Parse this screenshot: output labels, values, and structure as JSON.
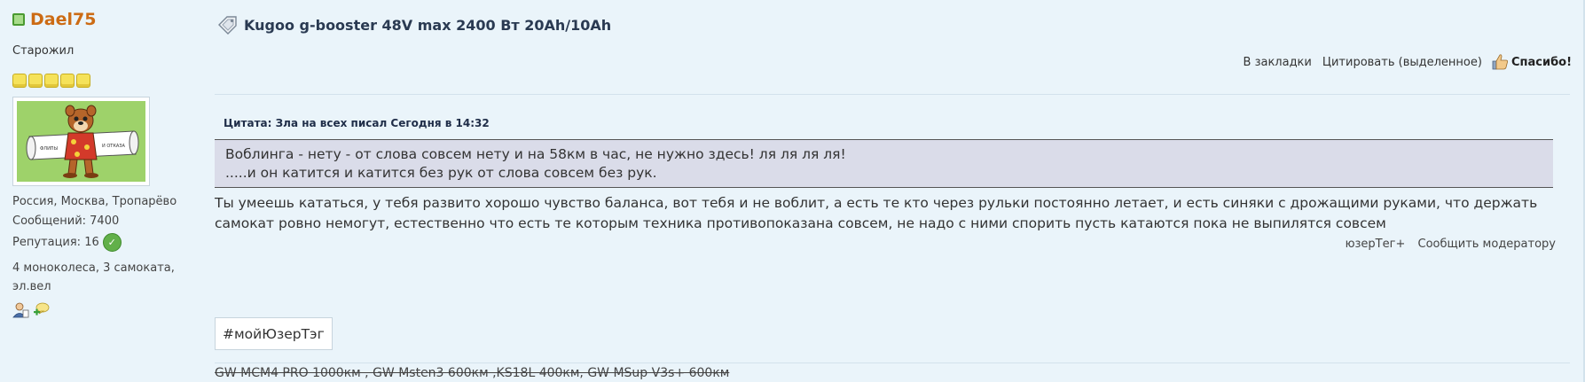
{
  "user": {
    "name": "Dael75",
    "title": "Старожил",
    "reputation_level": 5,
    "location": "Россия, Москва, Тропарёво",
    "posts": "Сообщений: 7400",
    "reputation": "Репутация: 16",
    "bio": "4 моноколеса, 3 самоката, эл.вел",
    "online_color": "#a8dc8a",
    "name_color": "#cc6b14"
  },
  "post": {
    "title": "Kugoo g-booster 48V max 2400 Вт 20Ah/10Ah",
    "actions": {
      "bookmark": "В закладки",
      "quote": "Цитировать (выделенное)",
      "thanks": "Спасибо!"
    },
    "quote_header": "Цитата: Зла на всех писал Сегодня в 14:32",
    "quote_lines": [
      "Воблинга - нету - от слова совсем нету и на 58км в час, не нужно здесь! ля ля ля ля!",
      ".....и он катится и катится без рук от слова совсем без рук."
    ],
    "body": "Ты умеешь кататься, у тебя развито хорошо чувство баланса, вот тебя и не воблит, а есть те кто через рульки постоянно летает, и есть синяки с дрожащими руками, что держать самокат ровно немогут, естественно что есть те которым техника противопоказана совсем, не надо с ними спорить пусть катаются пока не выпилятся совсем",
    "links": {
      "usertag": "юзерТег+",
      "report": "Сообщить модератору"
    },
    "tag_button": "#мойЮзерТэг",
    "signature": "GW MCM4 PRO 1000км , GW Msten3 600км ,KS18L 400км, GW MSup V3s+ 600км"
  },
  "icons": {
    "online": "online-status-icon",
    "rep_star": "reputation-star-icon",
    "rep_add": "add-reputation-icon",
    "profile": "user-profile-icon",
    "pm": "private-message-icon",
    "title": "post-tag-icon",
    "thanks": "thumbs-up-icon"
  }
}
